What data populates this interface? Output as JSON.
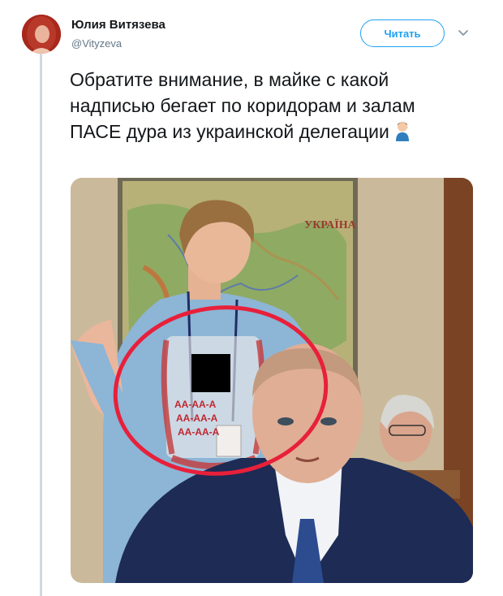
{
  "tweet": {
    "author_name": "Юлия Витязева",
    "author_handle": "@Vityzeva",
    "follow_label": "Читать",
    "text": "Обратите внимание, в майке с какой надписью бегает по коридорам и залам ПАСЕ дура из украинской делегации",
    "emoji": "man-facepalming-emoji"
  },
  "photo": {
    "map_label": "УКРАЇНА",
    "shirt_lines": [
      "АА-АА-А",
      "АА-АА-А",
      "АА-АА-А"
    ],
    "annotation_color": "#e8203a",
    "censor_color": "#000000"
  },
  "colors": {
    "accent": "#1da1f2",
    "handle": "#657786",
    "thread_line": "#cfd9de"
  }
}
